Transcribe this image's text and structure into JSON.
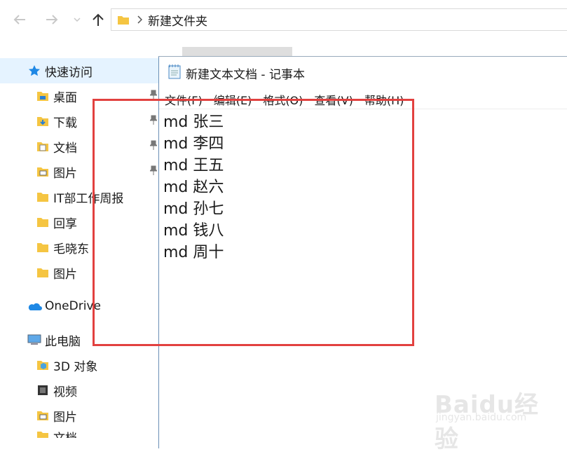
{
  "address_bar": {
    "path": "新建文件夹"
  },
  "nav_pane": {
    "quick_access": "快速访问",
    "items": [
      {
        "label": "桌面",
        "icon": "desktop-folder-icon",
        "pinned": true
      },
      {
        "label": "下载",
        "icon": "downloads-folder-icon",
        "pinned": true
      },
      {
        "label": "文档",
        "icon": "documents-folder-icon",
        "pinned": true
      },
      {
        "label": "图片",
        "icon": "pictures-folder-icon",
        "pinned": true
      },
      {
        "label": "IT部工作周报",
        "icon": "folder-icon"
      },
      {
        "label": "回享",
        "icon": "folder-icon"
      },
      {
        "label": "毛晓东",
        "icon": "folder-icon"
      },
      {
        "label": "图片",
        "icon": "folder-icon"
      }
    ],
    "onedrive": "OneDrive",
    "this_pc": "此电脑",
    "pc_items": [
      {
        "label": "3D 对象",
        "icon": "3d-objects-icon"
      },
      {
        "label": "视频",
        "icon": "videos-folder-icon"
      },
      {
        "label": "图片",
        "icon": "pictures-folder-icon"
      },
      {
        "label": "文档",
        "icon": "documents-folder-icon"
      }
    ]
  },
  "notepad": {
    "title": "新建文本文档 - 记事本",
    "menu": [
      "文件(F)",
      "编辑(E)",
      "格式(O)",
      "查看(V)",
      "帮助(H)"
    ],
    "lines": [
      "md 张三",
      "md 李四",
      "md 王五",
      "md 赵六",
      "md 孙七",
      "md 钱八",
      "md 周十"
    ]
  },
  "watermark": {
    "brand": "Baidu经验",
    "url": "jingyan.baidu.com"
  },
  "colors": {
    "highlight": "#e2413f",
    "selection": "#e5f3ff",
    "folder": "#f5c542"
  }
}
